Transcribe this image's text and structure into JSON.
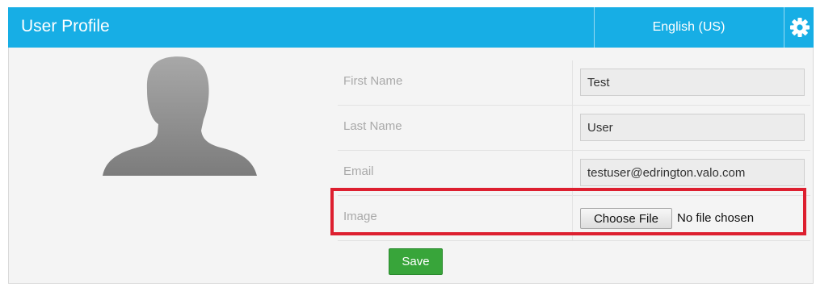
{
  "header": {
    "title": "User Profile",
    "language": "English (US)",
    "settings_icon": "gear-icon"
  },
  "avatar": {
    "icon": "user-silhouette-icon"
  },
  "form": {
    "first_name": {
      "label": "First Name",
      "value": "Test"
    },
    "last_name": {
      "label": "Last Name",
      "value": "User"
    },
    "email": {
      "label": "Email",
      "value": "testuser@edrington.valo.com"
    },
    "image": {
      "label": "Image",
      "button_label": "Choose File",
      "status": "No file chosen"
    },
    "save_label": "Save"
  },
  "colors": {
    "header_bg": "#17aee5",
    "highlight": "#dd1f2f",
    "save_button": "#38a53a"
  }
}
